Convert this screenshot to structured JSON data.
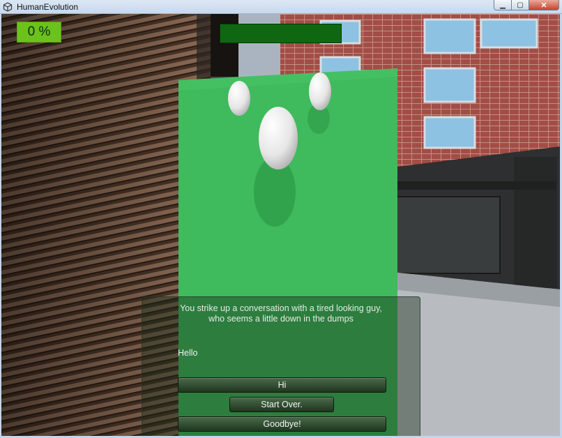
{
  "window": {
    "title": "HumanEvolution",
    "icon": "unity-logo-icon",
    "buttons": [
      "minimize-icon",
      "maximize-icon",
      "close-icon"
    ]
  },
  "hud": {
    "progress_label": "0 %",
    "progress_color": "#6cc21c",
    "health_fraction": 1.0,
    "health_color": "#0b4c0c"
  },
  "dialogue": {
    "narration_line1": "You strike up a conversation with a tired looking guy,",
    "narration_line2": "who seems a little down in the dumps",
    "npc_line": "Hello",
    "choices": [
      "Hi",
      "Start Over.",
      "Goodbye!"
    ]
  },
  "scene": {
    "character_color": "#3fba5c",
    "egg_color": "#f4f4f4"
  }
}
